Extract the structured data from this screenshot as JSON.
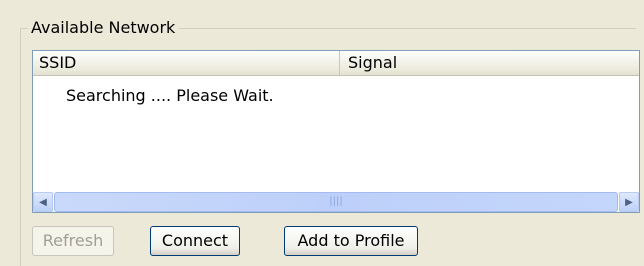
{
  "group": {
    "title": "Available Network"
  },
  "list": {
    "columns": [
      "SSID",
      "Signal"
    ],
    "status_text": "Searching .... Please Wait."
  },
  "buttons": {
    "refresh": "Refresh",
    "refresh_enabled": false,
    "connect": "Connect",
    "add_to_profile": "Add to Profile"
  },
  "icons": {
    "scroll_left": "scroll-left-arrow-icon",
    "scroll_right": "scroll-right-arrow-icon",
    "thumb_grip": "scrollbar-grip-icon"
  }
}
